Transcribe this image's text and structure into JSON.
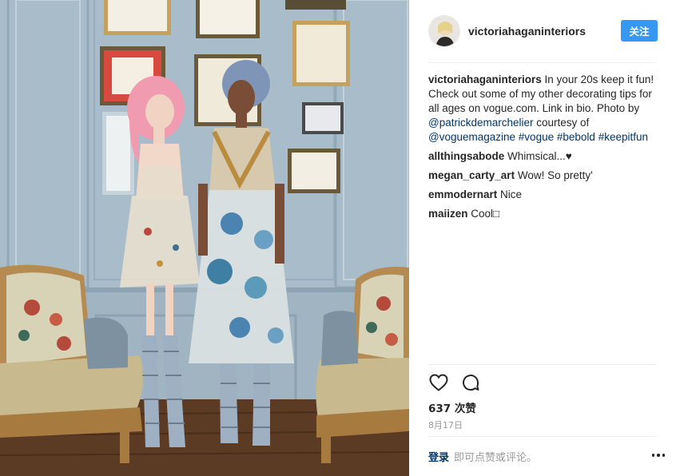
{
  "post": {
    "username": "victoriahaganinteriors",
    "follow_label": "关注",
    "caption": {
      "user": "victoriahaganinteriors",
      "text_1": " In your 20s keep it fun! Check out some of my other decorating tips for all ages on vogue.com. Link in bio. Photo by ",
      "mention_1": "@patrickdemarchelier",
      "text_2": " courtesy of ",
      "mention_2": "@voguemagazine",
      "hashtag_1": "#vogue",
      "hashtag_2": "#bebold",
      "hashtag_3": "#keepitfun"
    },
    "comments": [
      {
        "user": "allthingsabode",
        "text": "Whimsical...♥"
      },
      {
        "user": "megan_carty_art",
        "text": "Wow! So pretty'"
      },
      {
        "user": "emmodernart",
        "text": "Nice"
      },
      {
        "user": "maiizen",
        "text": "Cool□"
      }
    ],
    "likes": "637 次赞",
    "date": "8月17日",
    "login_label": "登录",
    "comment_prompt": "即可点赞或评论。",
    "icons": {
      "like": "heart-icon",
      "comment": "comment-icon",
      "more": "more-options-icon"
    },
    "colors": {
      "accent": "#3897f0",
      "link": "#003569",
      "muted": "#999999"
    }
  }
}
